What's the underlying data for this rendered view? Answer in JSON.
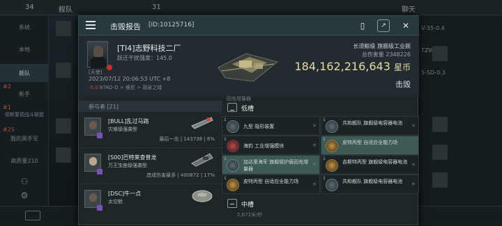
{
  "background": {
    "top_count": "34",
    "top_label": "舰队",
    "top_num": "31",
    "top_right": "聊天",
    "side_items": [
      "系统",
      "本地",
      "舰队",
      "新手",
      "军团",
      "联盟",
      "高质量210"
    ],
    "side_red": [
      "#2",
      "#1",
      "#25"
    ],
    "side_red_labels": [
      "新手",
      "德斯蒙德战斗联盟",
      "我的黑手军"
    ],
    "right_items": [
      "V-35-0.4",
      "TZW-0.2",
      "5-SD-0.3"
    ],
    "bottom_hint": "2,672米/秒"
  },
  "report": {
    "title": "击毁报告",
    "id": "[ID:10125716]",
    "victim_name": "[TI4]志野科技二厂",
    "victim_sub": "跃迁干扰强度：145.0",
    "victim_tag": "[天使]",
    "time": "2023/07/12 20:06:53 UTC +8",
    "location_sec": "-0.0",
    "location": "87KO-D > 维尼 > 源泉之域",
    "ship_name": "长须鲸级 旗舰级工业舰",
    "ship_value_label": "总伤害量",
    "ship_value": "2348226",
    "isk_value": "184,162,216,643",
    "isk_unit": "星币",
    "status": "击毁"
  },
  "participants": {
    "header": "参与者 [21]",
    "items": [
      {
        "name": "[BULL]乱过马路",
        "ship": "灾难级强袭型",
        "stat": "最后一击 | 143738 | 6%"
      },
      {
        "name": "[S00]巴特莱查普龙",
        "ship": "万王宝座级强袭型",
        "stat": "造成伤害最多 | 400872 | 17%"
      },
      {
        "name": "[DSC]牛一点",
        "ship": "太空舱",
        "stat": ""
      }
    ]
  },
  "fitting": {
    "top_label": "回充增量器",
    "low_label": "低槽",
    "mid_label": "中槽",
    "modules": [
      {
        "qty": "1",
        "name": "九型 隐形装置",
        "x": "✕",
        "icon": "grey"
      },
      {
        "qty": "1",
        "name": "共和舰队 旗舰级电容器电池",
        "x": "✕",
        "icon": "grey"
      },
      {
        "qty": "1",
        "name": "海豹 工业增强模块",
        "x": "✕",
        "icon": "red"
      },
      {
        "qty": "1",
        "name": "皮特丙型 自适应全能力场",
        "x": "",
        "icon": "gold"
      },
      {
        "qty": "1",
        "name": "加达里海军 旗舰级护盾回充增量器",
        "x": "✕",
        "icon": "grey"
      },
      {
        "qty": "1",
        "name": "吉斯特丙型 旗舰级电容器电池",
        "x": "✕",
        "icon": "gold"
      },
      {
        "qty": "1",
        "name": "皮特丙型 自适应全能力场",
        "x": "✕",
        "icon": "gold"
      },
      {
        "qty": "1",
        "name": "共和舰队 旗舰级电容器电池",
        "x": "✕",
        "icon": "grey"
      }
    ]
  }
}
